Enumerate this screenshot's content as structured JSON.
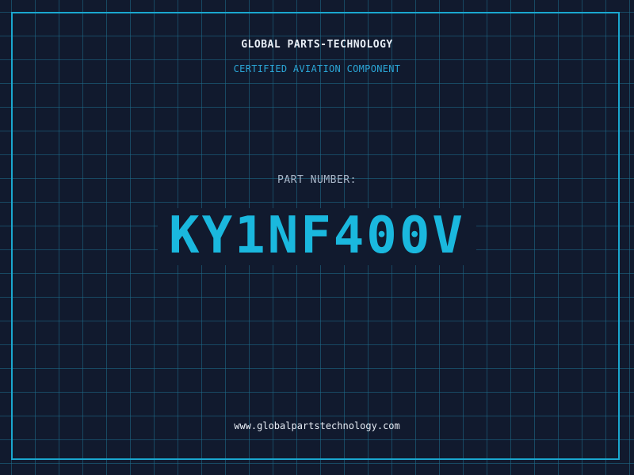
{
  "header": {
    "company_name": "GLOBAL PARTS-TECHNOLOGY",
    "tagline": "CERTIFIED AVIATION COMPONENT"
  },
  "part": {
    "label": "PART NUMBER:",
    "number": "KY1NF400V"
  },
  "footer": {
    "website": "www.globalpartstechnology.com"
  },
  "colors": {
    "background": "#111a2e",
    "grid": "#1e6e8c",
    "frame": "#1aa7cf",
    "accent": "#1ab8de",
    "title_text": "#e8eef6",
    "label_text": "#a9b6c8"
  }
}
